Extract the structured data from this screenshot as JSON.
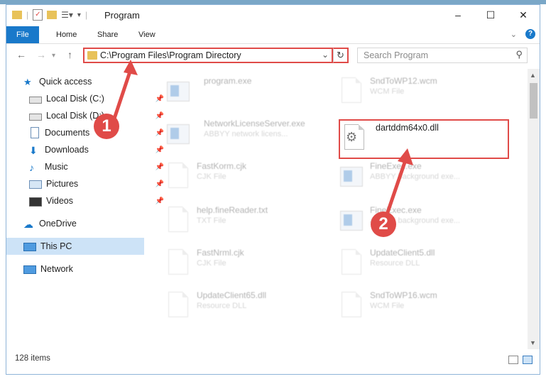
{
  "window": {
    "title": "Program",
    "controls": {
      "minimize": "–",
      "maximize": "☐",
      "close": "✕"
    }
  },
  "ribbon": {
    "tabs": [
      "File",
      "Home",
      "Share",
      "View"
    ],
    "help": "?"
  },
  "navigation": {
    "back": "←",
    "forward": "→",
    "up": "↑",
    "address_path": "C:\\Program Files\\Program Directory",
    "refresh": "↻",
    "search_placeholder": "Search Program"
  },
  "sidebar": {
    "items": [
      {
        "label": "Quick access",
        "icon": "star-icon"
      },
      {
        "label": "Local Disk (C:)",
        "icon": "disk-icon",
        "pinned": true
      },
      {
        "label": "Local Disk (D:)",
        "icon": "disk-icon",
        "pinned": true
      },
      {
        "label": "Documents",
        "icon": "document-icon",
        "pinned": true
      },
      {
        "label": "Downloads",
        "icon": "download-icon",
        "pinned": true
      },
      {
        "label": "Music",
        "icon": "music-icon",
        "pinned": true
      },
      {
        "label": "Pictures",
        "icon": "picture-icon",
        "pinned": true
      },
      {
        "label": "Videos",
        "icon": "video-icon",
        "pinned": true
      },
      {
        "label": "OneDrive",
        "icon": "cloud-icon"
      },
      {
        "label": "This PC",
        "icon": "computer-icon",
        "selected": true
      },
      {
        "label": "Network",
        "icon": "network-icon"
      }
    ]
  },
  "files": [
    {
      "name": "program.exe",
      "type": ""
    },
    {
      "name": "SndToWP12.wcm",
      "type": "WCM File"
    },
    {
      "name": "NetworkLicenseServer.exe",
      "type": "ABBYY network licens..."
    },
    {
      "name": "dartddm64x0.dll",
      "type": ""
    },
    {
      "name": "FastKorm.cjk",
      "type": "CJK File"
    },
    {
      "name": "FineExec.exe",
      "type": "ABBYY background exe..."
    },
    {
      "name": "help.fineReader.txt",
      "type": "TXT File"
    },
    {
      "name": "FineExec.exe",
      "type": "ABBYY background exe..."
    },
    {
      "name": "FastNrml.cjk",
      "type": "CJK File"
    },
    {
      "name": "UpdateClient5.dll",
      "type": "Resource DLL"
    },
    {
      "name": "UpdateClient65.dll",
      "type": "Resource DLL"
    },
    {
      "name": "SndToWP16.wcm",
      "type": "WCM File"
    }
  ],
  "status": {
    "item_count": "128 items"
  },
  "callouts": [
    "1",
    "2"
  ],
  "colors": {
    "accent": "#1979ca",
    "highlight": "#e04b48"
  }
}
